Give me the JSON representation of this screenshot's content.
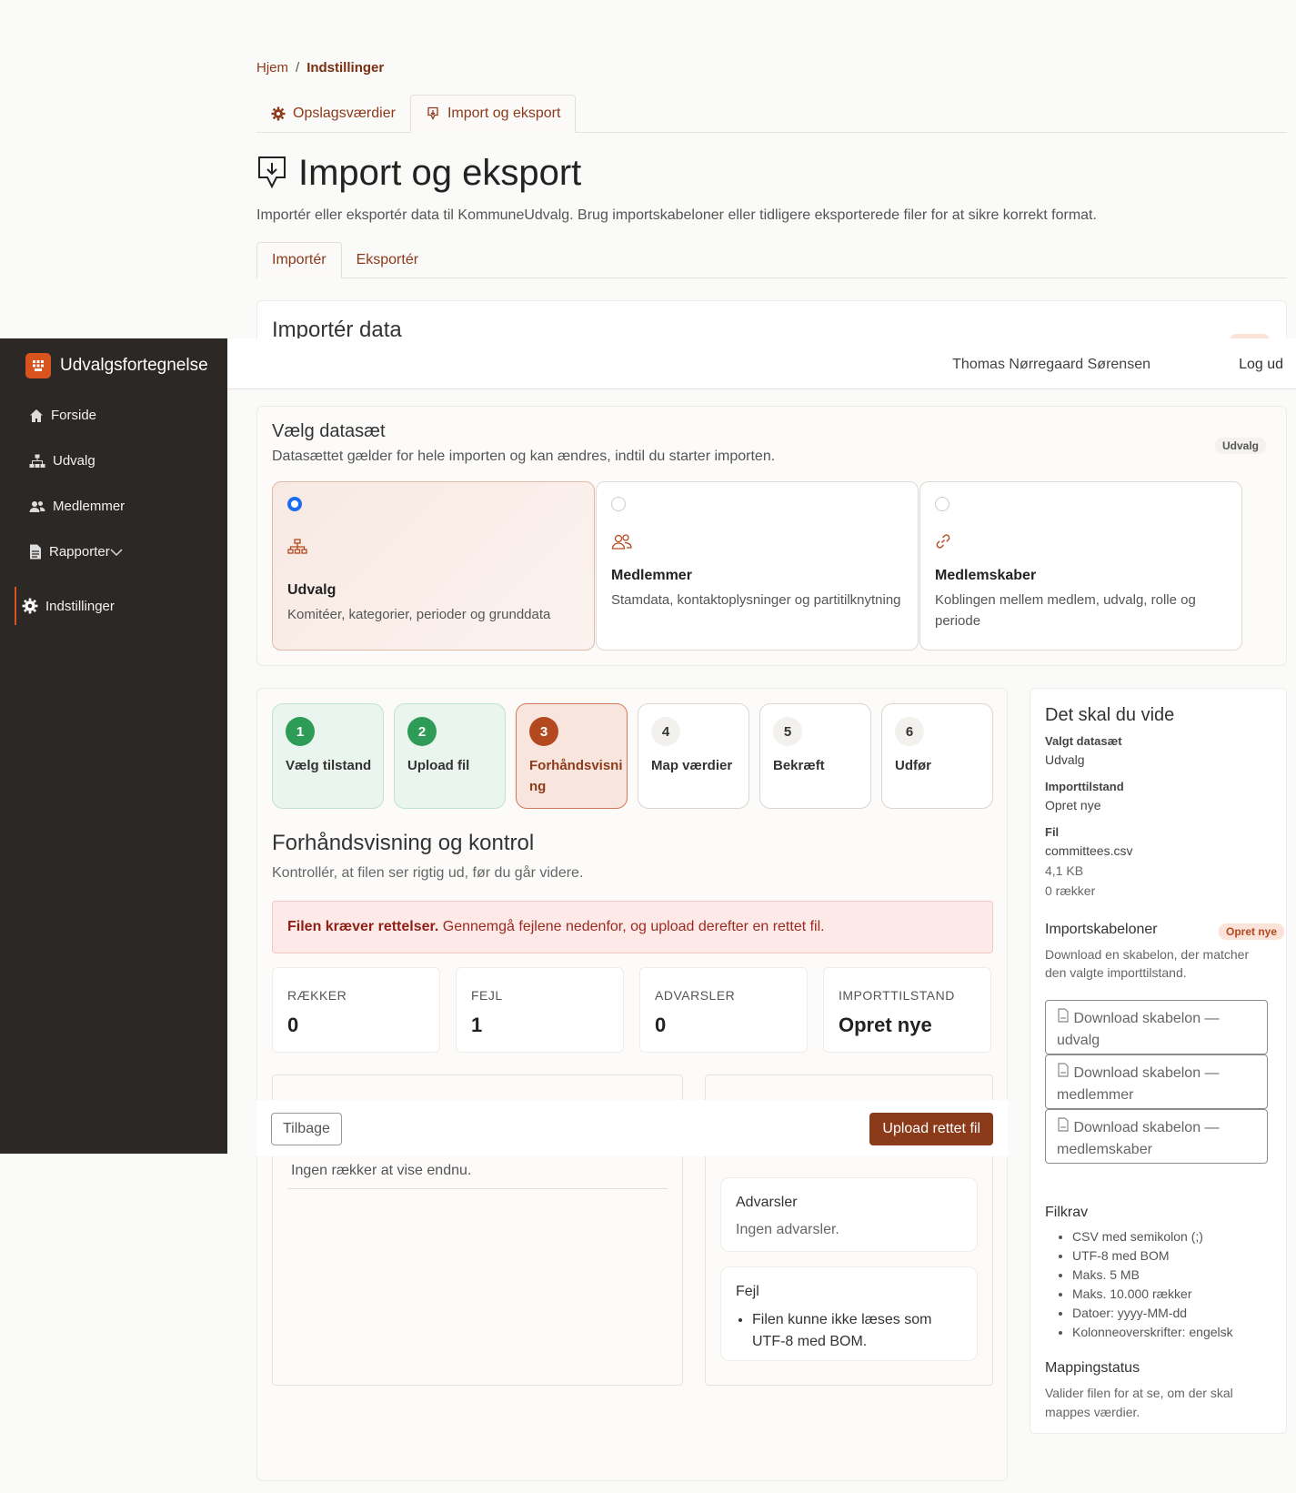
{
  "breadcrumb": {
    "home": "Hjem",
    "separator": "/",
    "current": "Indstillinger"
  },
  "top_tabs": [
    {
      "label": "Opslagsværdier",
      "icon": "gear-icon"
    },
    {
      "label": "Import og eksport",
      "icon": "download-tray-icon"
    }
  ],
  "page": {
    "title": "Import og eksport",
    "description": "Importér eller eksportér data til KommuneUdvalg. Brug importskabeloner eller tidligere eksporterede filer for at sikre korrekt format."
  },
  "sub_tabs": [
    "Importér",
    "Eksportér"
  ],
  "import_card": {
    "title": "Importér data"
  },
  "sidebar": {
    "brand": "Udvalgsfortegnelse",
    "items": [
      {
        "label": "Forside",
        "icon": "home-icon"
      },
      {
        "label": "Udvalg",
        "icon": "org-chart-icon"
      },
      {
        "label": "Medlemmer",
        "icon": "users-icon"
      },
      {
        "label": "Rapporter",
        "icon": "document-icon"
      },
      {
        "label": "Indstillinger",
        "icon": "gear-icon"
      }
    ]
  },
  "header": {
    "user": "Thomas Nørregaard Sørensen",
    "logout": "Log ud"
  },
  "dataset": {
    "title": "Vælg datasæt",
    "subtitle": "Datasættet gælder for hele importen og kan ændres, indtil du starter importen.",
    "badge": "Udvalg",
    "options": [
      {
        "name": "Udvalg",
        "desc": "Komitéer, kategorier, perioder og grunddata",
        "selected": true
      },
      {
        "name": "Medlemmer",
        "desc": "Stamdata, kontaktoplysninger og partitilknytning",
        "selected": false
      },
      {
        "name": "Medlemskaber",
        "desc": "Koblingen mellem medlem, udvalg, rolle og periode",
        "selected": false
      }
    ]
  },
  "steps": [
    {
      "num": "1",
      "label": "Vælg tilstand",
      "state": "done"
    },
    {
      "num": "2",
      "label": "Upload fil",
      "state": "done"
    },
    {
      "num": "3",
      "label": "Forhåndsvisning",
      "state": "current"
    },
    {
      "num": "4",
      "label": "Map værdier",
      "state": "todo"
    },
    {
      "num": "5",
      "label": "Bekræft",
      "state": "todo"
    },
    {
      "num": "6",
      "label": "Udfør",
      "state": "todo"
    }
  ],
  "preview": {
    "title": "Forhåndsvisning og kontrol",
    "subtitle": "Kontrollér, at filen ser rigtig ud, før du går videre.",
    "alert_strong": "Filen kræver rettelser.",
    "alert_text": " Gennemgå fejlene nedenfor, og upload derefter en rettet fil.",
    "stats": [
      {
        "label": "RÆKKER",
        "value": "0"
      },
      {
        "label": "FEJL",
        "value": "1"
      },
      {
        "label": "ADVARSLER",
        "value": "0"
      },
      {
        "label": "IMPORTTILSTAND",
        "value": "Opret nye"
      }
    ],
    "empty_rows": "Ingen rækker at vise endnu.",
    "warnings_title": "Advarsler",
    "warnings_body": "Ingen advarsler.",
    "errors_title": "Fejl",
    "errors": [
      "Filen kunne ikke læses som UTF-8 med BOM."
    ]
  },
  "footer": {
    "back": "Tilbage",
    "upload": "Upload rettet fil"
  },
  "info": {
    "title": "Det skal du vide",
    "dataset_label": "Valgt datasæt",
    "dataset_value": "Udvalg",
    "mode_label": "Importtilstand",
    "mode_value": "Opret nye",
    "file_label": "Fil",
    "file_name": "committees.csv",
    "file_size": "4,1 KB",
    "file_rows": "0 rækker",
    "templates_title": "Importskabeloner",
    "templates_badge": "Opret nye",
    "templates_desc": "Download en skabelon, der matcher den valgte importtilstand.",
    "templates": [
      "Download skabelon — udvalg",
      "Download skabelon — medlemmer",
      "Download skabelon — medlemskaber"
    ],
    "requirements_title": "Filkrav",
    "requirements": [
      "CSV med semikolon (;)",
      "UTF-8 med BOM",
      "Maks. 5 MB",
      "Maks. 10.000 rækker",
      "Datoer: yyyy-MM-dd",
      "Kolonneoverskrifter: engelsk"
    ],
    "mapping_title": "Mappingstatus",
    "mapping_desc": "Valider filen for at se, om der skal mappes værdier."
  },
  "colors": {
    "accent": "#8b3a1a",
    "sidebar": "#2b2825",
    "success": "#2e9b57",
    "error_bg": "#fce9e8"
  }
}
